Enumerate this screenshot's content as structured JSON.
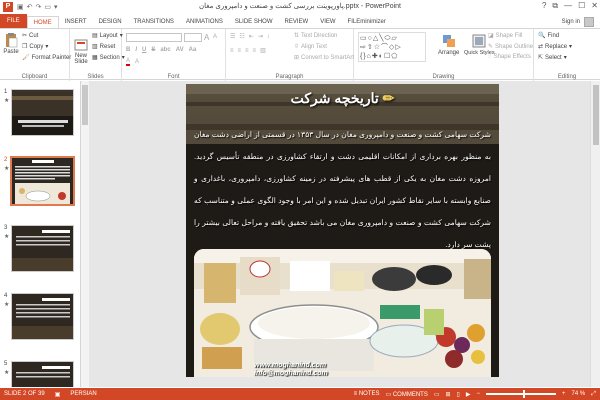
{
  "window": {
    "title": "پاورپوینت بررسی کشت و صنعت و دامپروری مغان.pptx - PowerPoint",
    "app_icon": "P",
    "controls": [
      "?",
      "⧉",
      "—",
      "☐",
      "✕"
    ]
  },
  "tabs": {
    "file": "FILE",
    "items": [
      "HOME",
      "INSERT",
      "DESIGN",
      "TRANSITIONS",
      "ANIMATIONS",
      "SLIDE SHOW",
      "REVIEW",
      "VIEW",
      "FILEminimizer"
    ],
    "active": "HOME",
    "signin": "Sign in"
  },
  "ribbon": {
    "clipboard": {
      "label": "Clipboard",
      "paste": "Paste",
      "cut": "Cut",
      "copy": "Copy",
      "format_painter": "Format Painter"
    },
    "slides": {
      "label": "Slides",
      "new_slide": "New",
      "new_slide2": "Slide",
      "layout": "Layout",
      "reset": "Reset",
      "section": "Section"
    },
    "font": {
      "label": "Font",
      "size_a_up": "A",
      "size_a_down": "A"
    },
    "paragraph": {
      "label": "Paragraph",
      "text_direction": "Text Direction",
      "align_text": "Align Text",
      "smartart": "Convert to SmartArt"
    },
    "drawing": {
      "label": "Drawing",
      "arrange": "Arrange",
      "quick_styles": "Quick Styles",
      "shape_fill": "Shape Fill",
      "shape_outline": "Shape Outline",
      "shape_effects": "Shape Effects"
    },
    "editing": {
      "label": "Editing",
      "find": "Find",
      "replace": "Replace",
      "select": "Select"
    }
  },
  "thumbnails": {
    "slides": [
      {
        "num": "1",
        "star": "★",
        "selected": false
      },
      {
        "num": "2",
        "star": "★",
        "selected": true
      },
      {
        "num": "3",
        "star": "★",
        "selected": false
      },
      {
        "num": "4",
        "star": "★",
        "selected": false
      },
      {
        "num": "5",
        "star": "★",
        "selected": false
      }
    ]
  },
  "slide": {
    "title": "تاریخچه شرکت",
    "body": "شرکت سهامی کشت و صنعت و دامپروری مغان در سال ۱۳۵۳ در قسمتی از اراضی دشت مغان به منظور بهره برداری از امکانات اقلیمی دشت و ارتقاء کشاورزی در منطقه تأسیس گردید. امروزه دشت مغان به یکی از قطب های پیشرفته در زمینه کشاورزی، دامپروری، باغداری و صنایع وابسته با سایر نقاط کشور ایران تبدیل شده و این امر با وجود الگوی عملی و متناسب که شرکت سهامی کشت و صنعت و دامپروری مغان می باشد تحقیق یافته و مراحل تعالی بیشتر را پشت سر دارد.",
    "url1": "www.moghanind.com",
    "url2": "info@moghanind.com"
  },
  "status": {
    "slide_of": "SLIDE 2 OF 39",
    "language": "PERSIAN",
    "notes": "NOTES",
    "comments": "COMMENTS",
    "zoom": "74 %",
    "zoom_fraction": 0.55
  },
  "colors": {
    "accent": "#d24726",
    "selected_thumb_border": "#e07a4e"
  }
}
